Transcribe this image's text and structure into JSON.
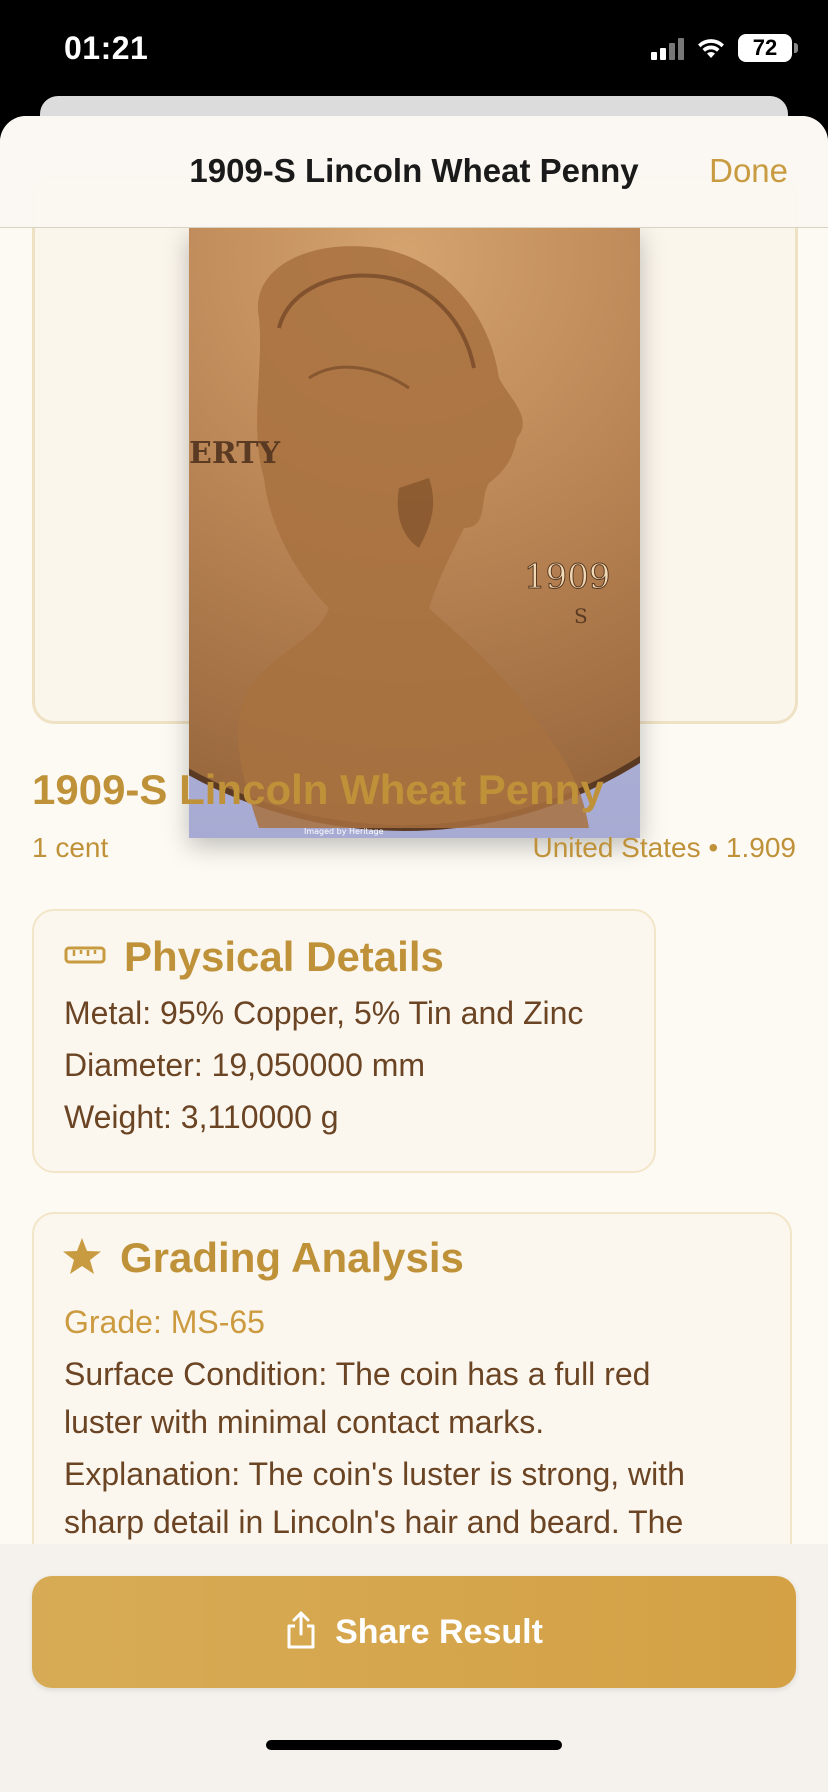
{
  "status_bar": {
    "time": "01:21",
    "battery": "72"
  },
  "nav": {
    "title": "1909-S Lincoln Wheat Penny",
    "done_label": "Done"
  },
  "coin_photo": {
    "inscription_left": "ERTY",
    "date": "1909",
    "mint_mark": "S",
    "footer_text": "Imaged by Heritage"
  },
  "coin": {
    "name": "1909-S Lincoln Wheat Penny",
    "denomination": "1 cent",
    "origin": "United States • 1.909"
  },
  "physical": {
    "title": "Physical Details",
    "icon": "ruler-icon",
    "metal": "Metal: 95% Copper, 5% Tin and Zinc",
    "diameter": "Diameter: 19,050000 mm",
    "weight": "Weight: 3,110000 g"
  },
  "grading": {
    "title": "Grading Analysis",
    "icon": "star-icon",
    "grade": "Grade: MS-65",
    "surface_line1": "Surface Condition: The coin has a full red",
    "surface_line2": "luster with minimal contact marks.",
    "explanation_line1": "Explanation: The coin's luster is strong, with",
    "explanation_line2": "sharp detail in Lincoln's hair and beard. The"
  },
  "share": {
    "label": "Share Result",
    "icon": "share-icon"
  },
  "colors": {
    "accent": "#c89b40",
    "title_gold": "#bf9239",
    "body_brown": "#6b4424",
    "button": "#d4a549"
  }
}
